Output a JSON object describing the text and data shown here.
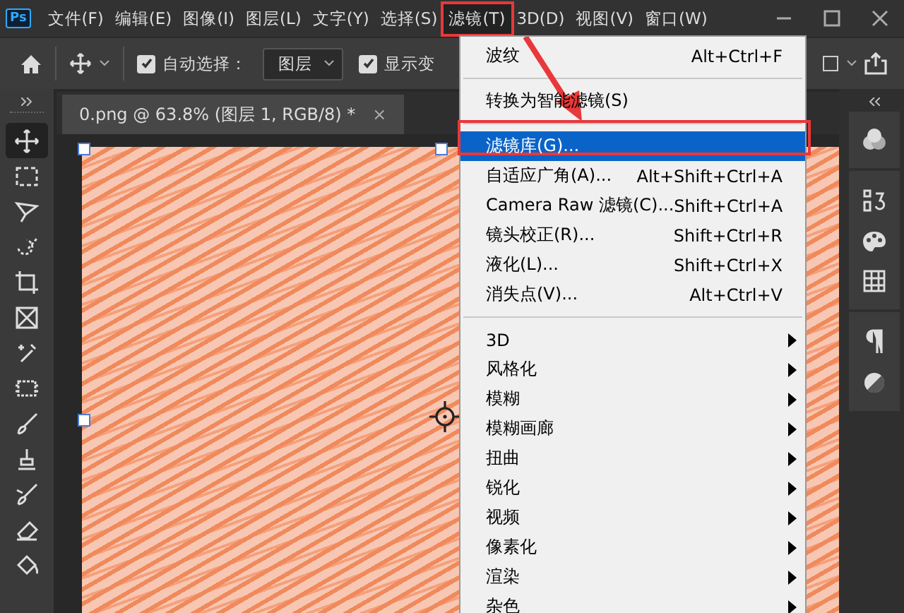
{
  "app_logo": "Ps",
  "menu_bar": [
    {
      "label": "文件(F)",
      "selected": false
    },
    {
      "label": "编辑(E)",
      "selected": false
    },
    {
      "label": "图像(I)",
      "selected": false
    },
    {
      "label": "图层(L)",
      "selected": false
    },
    {
      "label": "文字(Y)",
      "selected": false
    },
    {
      "label": "选择(S)",
      "selected": false
    },
    {
      "label": "滤镜(T)",
      "selected": true
    },
    {
      "label": "3D(D)",
      "selected": false
    },
    {
      "label": "视图(V)",
      "selected": false
    },
    {
      "label": "窗口(W)",
      "selected": false
    }
  ],
  "options_bar": {
    "auto_select": {
      "label": "自动选择：",
      "checked": true
    },
    "auto_select_target": "图层",
    "show_transform": {
      "label": "显示变",
      "checked": true
    }
  },
  "document_tab": {
    "title": "0.png @ 63.8% (图层 1, RGB/8) *",
    "close": "×"
  },
  "tools": [
    {
      "selected": true
    },
    {
      "selected": false
    },
    {
      "selected": false
    },
    {
      "selected": false
    },
    {
      "selected": false
    },
    {
      "selected": false
    },
    {
      "selected": false
    },
    {
      "selected": false
    },
    {
      "selected": false
    },
    {
      "selected": false
    },
    {
      "selected": false
    },
    {
      "selected": false
    },
    {
      "selected": false
    }
  ],
  "filter_menu": [
    [
      {
        "label": "波纹",
        "shortcut": "Alt+Ctrl+F",
        "submenu": false,
        "selected": false
      }
    ],
    [
      {
        "label": "转换为智能滤镜(S)",
        "submenu": false,
        "selected": false
      }
    ],
    [
      {
        "label": "滤镜库(G)...",
        "submenu": false,
        "selected": true
      },
      {
        "label": "自适应广角(A)...",
        "shortcut": "Alt+Shift+Ctrl+A",
        "submenu": false,
        "selected": false
      },
      {
        "label": "Camera Raw 滤镜(C)...",
        "shortcut": "Shift+Ctrl+A",
        "submenu": false,
        "selected": false
      },
      {
        "label": "镜头校正(R)...",
        "shortcut": "Shift+Ctrl+R",
        "submenu": false,
        "selected": false
      },
      {
        "label": "液化(L)...",
        "shortcut": "Shift+Ctrl+X",
        "submenu": false,
        "selected": false
      },
      {
        "label": "消失点(V)...",
        "shortcut": "Alt+Ctrl+V",
        "submenu": false,
        "selected": false
      }
    ],
    [
      {
        "label": "3D",
        "submenu": true,
        "selected": false
      },
      {
        "label": "风格化",
        "submenu": true,
        "selected": false
      },
      {
        "label": "模糊",
        "submenu": true,
        "selected": false
      },
      {
        "label": "模糊画廊",
        "submenu": true,
        "selected": false
      },
      {
        "label": "扭曲",
        "submenu": true,
        "selected": false
      },
      {
        "label": "锐化",
        "submenu": true,
        "selected": false
      },
      {
        "label": "视频",
        "submenu": true,
        "selected": false
      },
      {
        "label": "像素化",
        "submenu": true,
        "selected": false
      },
      {
        "label": "渲染",
        "submenu": true,
        "selected": false
      },
      {
        "label": "杂色",
        "submenu": true,
        "selected": false
      }
    ]
  ]
}
